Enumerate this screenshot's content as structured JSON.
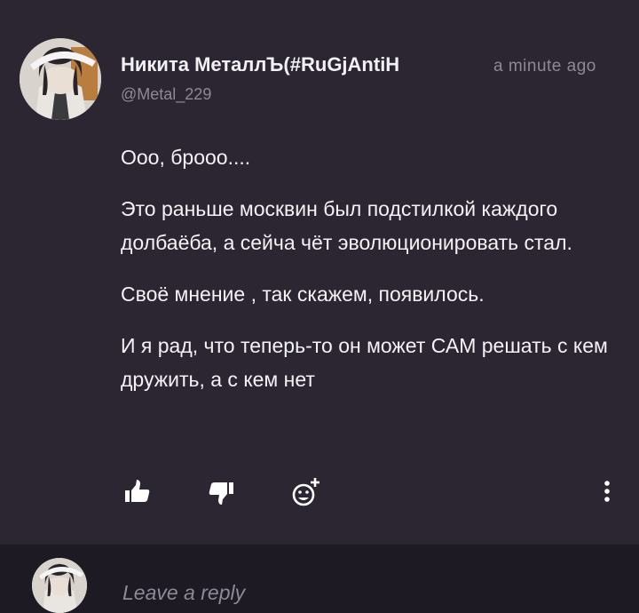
{
  "comment": {
    "author_name": "Никита МеталлЪ(#RuGjAntiH",
    "timestamp": "a minute ago",
    "handle": "@Metal_229",
    "paragraphs": [
      "Ооо, брооо....",
      "Это раньше москвин был подстилкой каждого долбаёба, а сейча чёт эволюционировать стал.",
      "Своё мнение , так скажем, появилось.",
      "И я рад, что теперь-то он может САМ решать с кем дружить, а с кем нет"
    ]
  },
  "actions": {
    "like_icon": "thumbs-up-icon",
    "dislike_icon": "thumbs-down-icon",
    "react_icon": "add-reaction-icon",
    "more_icon": "more-vertical-icon"
  },
  "reply": {
    "placeholder": "Leave a reply"
  },
  "colors": {
    "background": "#2b2631",
    "reply_bar": "#1d1a23",
    "muted_text": "#8f8898",
    "text": "#f4f2f6"
  }
}
